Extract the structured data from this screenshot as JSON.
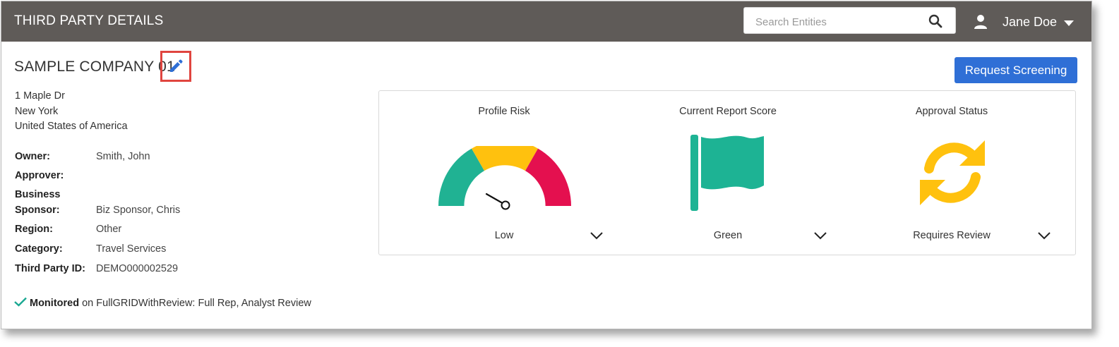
{
  "header": {
    "title": "THIRD PARTY DETAILS",
    "search_placeholder": "Search Entities",
    "user_name": "Jane Doe"
  },
  "company": {
    "name": "SAMPLE COMPANY 01",
    "address": [
      "1 Maple Dr",
      "New York",
      "United States of America"
    ],
    "request_button": "Request Screening"
  },
  "details": [
    {
      "label": "Owner:",
      "value": "Smith, John"
    },
    {
      "label": "Approver:",
      "value": ""
    },
    {
      "label": "Business",
      "value": ""
    },
    {
      "label": "Sponsor:",
      "value": "Biz Sponsor, Chris"
    },
    {
      "label": "Region:",
      "value": "Other"
    },
    {
      "label": "Category:",
      "value": "Travel Services"
    },
    {
      "label": "Third Party ID:",
      "value": "DEMO000002529"
    }
  ],
  "monitoring": {
    "status": "Monitored",
    "text": "on FullGRIDWithReview: Full Rep, Analyst Review"
  },
  "cards": [
    {
      "title": "Profile Risk",
      "value": "Low",
      "icon": "risk-gauge-icon"
    },
    {
      "title": "Current Report Score",
      "value": "Green",
      "icon": "flag-icon"
    },
    {
      "title": "Approval Status",
      "value": "Requires Review",
      "icon": "refresh-icon"
    }
  ],
  "colors": {
    "topbar": "#5f5b58",
    "accent_blue": "#2f6fd6",
    "gauge_green": "#20b293",
    "gauge_yellow": "#ffc10e",
    "gauge_red": "#e4104f",
    "flag_green": "#1db394",
    "status_yellow": "#ffc10e",
    "check_teal": "#1aa892",
    "highlight_red": "#e0453f"
  }
}
